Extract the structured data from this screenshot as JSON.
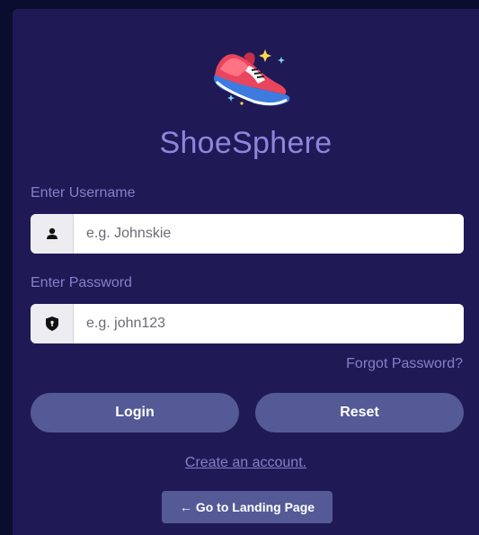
{
  "brand": {
    "name": "ShoeSphere",
    "logo_icon": "sneaker-icon"
  },
  "form": {
    "username_label": "Enter Username",
    "username_placeholder": "e.g. Johnskie",
    "username_icon": "user-icon",
    "password_label": "Enter Password",
    "password_placeholder": "e.g. john123",
    "password_icon": "shield-icon",
    "forgot_password": "Forgot Password?"
  },
  "actions": {
    "login_label": "Login",
    "reset_label": "Reset",
    "create_account": "Create an account.",
    "landing_label": "← Go to Landing Page"
  },
  "colors": {
    "background": "#0b0d2e",
    "card": "#1f1a56",
    "brand_text": "#8e86dc",
    "label_text": "#8580c8",
    "button": "#545a96"
  }
}
